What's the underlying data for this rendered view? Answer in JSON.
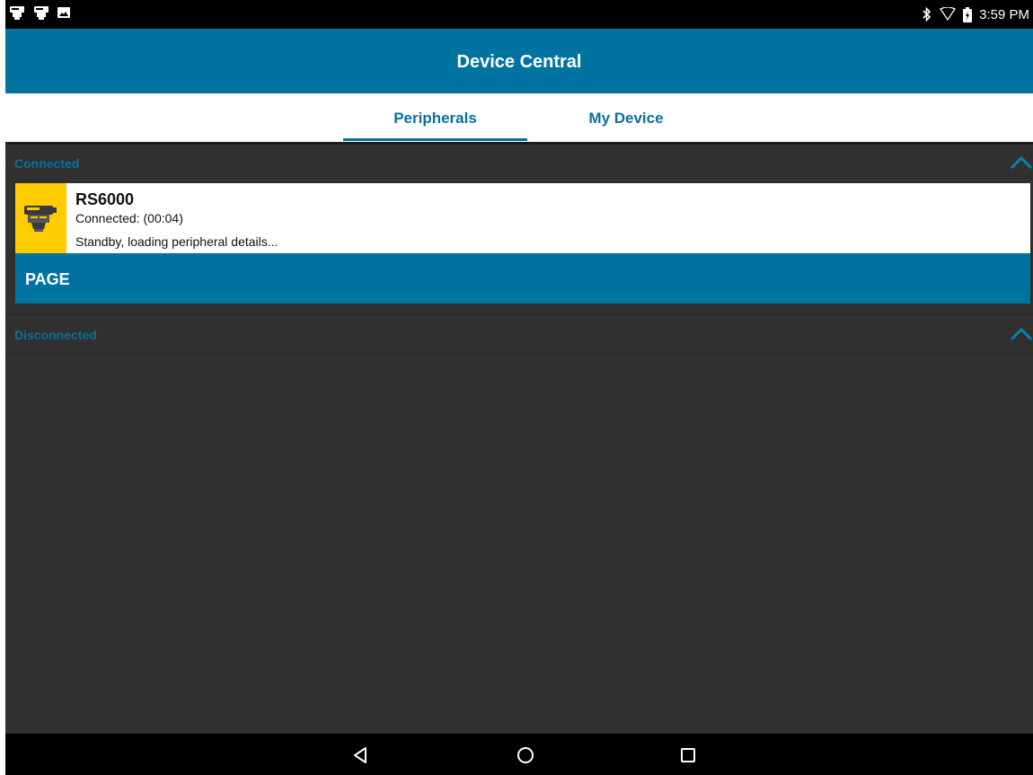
{
  "status_bar": {
    "left_icons": [
      "scanner-notification-icon",
      "scanner-notification-icon",
      "image-notification-icon"
    ],
    "right_icons": [
      "bluetooth-icon",
      "wifi-icon",
      "battery-charging-icon"
    ],
    "time": "3:59 PM"
  },
  "app_bar": {
    "title": "Device Central"
  },
  "tabs": [
    {
      "label": "Peripherals",
      "selected": true
    },
    {
      "label": "My Device",
      "selected": false
    }
  ],
  "sections": {
    "connected": {
      "label": "Connected",
      "expanded": true
    },
    "disconnected": {
      "label": "Disconnected",
      "expanded": true
    }
  },
  "devices": [
    {
      "name": "RS6000",
      "status": "Connected: (00:04)",
      "detail": "Standby, loading peripheral details...",
      "icon": "ring-scanner-icon",
      "action_label": "PAGE"
    }
  ],
  "nav_bar": {
    "buttons": [
      "back-icon",
      "home-icon",
      "recents-icon"
    ]
  },
  "colors": {
    "accent": "#0073a0",
    "tab_text": "#0a6f9d",
    "background": "#303030",
    "device_thumb": "#ffcc00"
  }
}
